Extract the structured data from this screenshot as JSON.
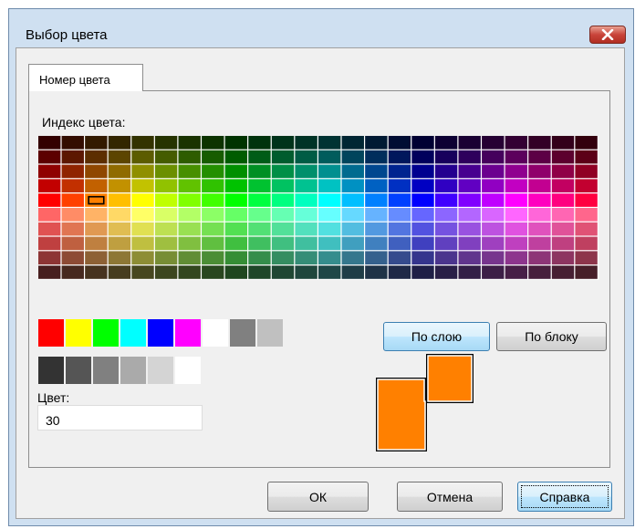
{
  "window": {
    "title": "Выбор цвета",
    "close_icon": "close-icon"
  },
  "tabs": [
    {
      "label": "Номер цвета",
      "selected": true
    }
  ],
  "palette": {
    "label": "Индекс цвета:",
    "columns": 24,
    "rows": 10,
    "hues": [
      0,
      15,
      30,
      45,
      60,
      75,
      90,
      105,
      120,
      135,
      150,
      165,
      180,
      195,
      210,
      225,
      240,
      255,
      270,
      285,
      300,
      315,
      330,
      345
    ],
    "selected": {
      "row": 4,
      "col": 2
    },
    "selection_color": "#000000"
  },
  "standard_colors": {
    "row1": [
      "#ff0000",
      "#ffff00",
      "#00ff00",
      "#00ffff",
      "#0000ff",
      "#ff00ff",
      "#ffffff",
      "#808080",
      "#c0c0c0"
    ],
    "row2": [
      "#333333",
      "#555555",
      "#808080",
      "#aaaaaa",
      "#d4d4d4",
      "#ffffff"
    ]
  },
  "color_field": {
    "label": "Цвет:",
    "value": "30"
  },
  "buttons": {
    "by_layer": "По слою",
    "by_block": "По блоку",
    "ok": "ОК",
    "cancel": "Отмена",
    "help": "Справка"
  },
  "preview": {
    "new_color": "#ff8000",
    "old_color": "#ff8000"
  },
  "colors": {
    "titlebar": "#cfe0f1",
    "dialog_bg": "#f0f0f0",
    "button_active": "#bee6fd",
    "close_button": "#c9443a"
  }
}
